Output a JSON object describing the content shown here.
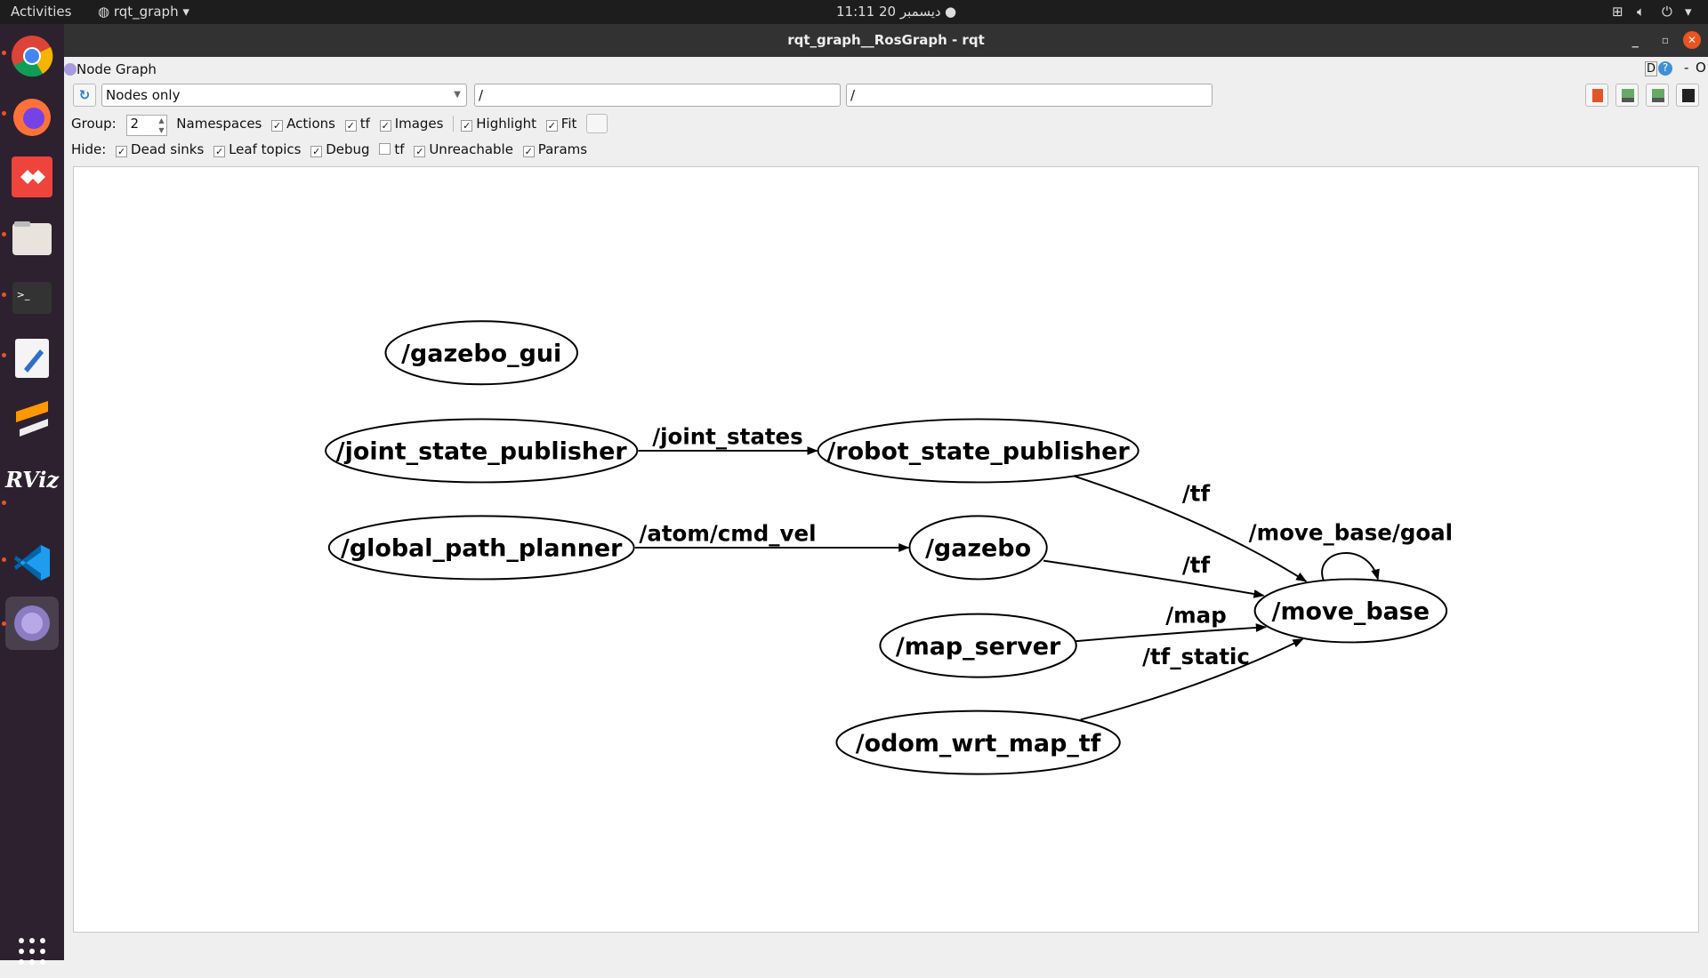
{
  "topbar": {
    "activities": "Activities",
    "app_menu": "rqt_graph",
    "clock": "11:11  20 ديسمبر"
  },
  "dock": {
    "items": [
      "chrome-icon",
      "firefox-icon",
      "anydesk-icon",
      "files-icon",
      "terminal-icon",
      "text-editor-icon",
      "sublime-icon",
      "rviz-icon",
      "vscode-icon",
      "rqt-icon"
    ],
    "apps": "show-applications-icon",
    "rviz_label": "RViz"
  },
  "window": {
    "title": "rqt_graph__RosGraph - rqt"
  },
  "plugin": {
    "title": "Node Graph",
    "d_label": "D",
    "help_label": "?",
    "minus_label": "-",
    "o_label": "O"
  },
  "toolbar": {
    "mode": "Nodes only",
    "filter1": "/",
    "filter2": "/"
  },
  "options": {
    "group_label": "Group:",
    "group_value": "2",
    "namespaces": "Namespaces",
    "actions": "Actions",
    "tf": "tf",
    "images": "Images",
    "highlight": "Highlight",
    "fit": "Fit",
    "check": "✓"
  },
  "hide": {
    "label": "Hide:",
    "dead_sinks": "Dead sinks",
    "leaf_topics": "Leaf topics",
    "debug": "Debug",
    "tf": "tf",
    "unreachable": "Unreachable",
    "params": "Params"
  },
  "graph": {
    "nodes": [
      "/gazebo_gui",
      "/joint_state_publisher",
      "/robot_state_publisher",
      "/global_path_planner",
      "/gazebo",
      "/move_base",
      "/map_server",
      "/odom_wrt_map_tf"
    ],
    "edges": [
      {
        "from": "/joint_state_publisher",
        "to": "/robot_state_publisher",
        "label": "/joint_states"
      },
      {
        "from": "/global_path_planner",
        "to": "/gazebo",
        "label": "/atom/cmd_vel"
      },
      {
        "from": "/robot_state_publisher",
        "to": "/move_base",
        "label": "/tf"
      },
      {
        "from": "/gazebo",
        "to": "/move_base",
        "label": "/tf"
      },
      {
        "from": "/map_server",
        "to": "/move_base",
        "label": "/map"
      },
      {
        "from": "/odom_wrt_map_tf",
        "to": "/move_base",
        "label": "/tf_static"
      },
      {
        "from": "/move_base",
        "to": "/move_base",
        "label": "/move_base/goal"
      }
    ]
  }
}
